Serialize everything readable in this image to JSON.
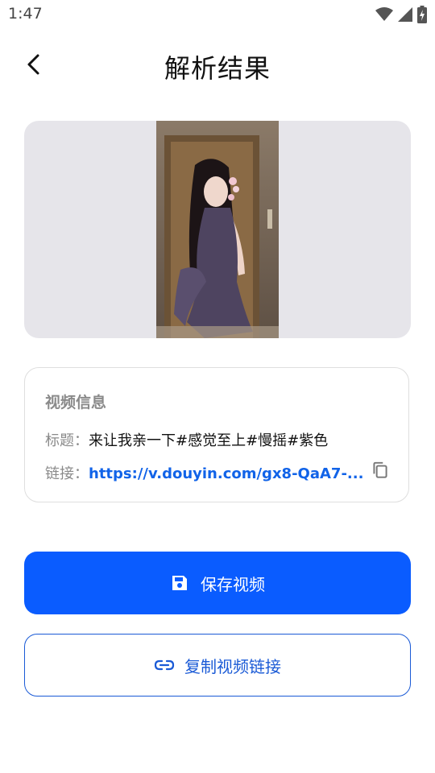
{
  "status_bar": {
    "time": "1:47",
    "icons": [
      "wifi-icon",
      "signal-icon",
      "battery-charging-icon"
    ]
  },
  "app_bar": {
    "title": "解析结果",
    "back_icon": "chevron-left-icon"
  },
  "preview": {
    "image_description": "video-thumbnail"
  },
  "info_card": {
    "heading": "视频信息",
    "title_label": "标题：",
    "title_value": "来让我亲一下#感觉至上#慢摇#紫色",
    "link_label": "链接：",
    "link_value": "https://v.douyin.com/gx8-QaA7-...",
    "copy_icon": "copy-icon"
  },
  "actions": {
    "save_label": "保存视频",
    "save_icon": "floppy-disk-icon",
    "copy_link_label": "复制视频链接",
    "copy_link_icon": "link-icon"
  },
  "colors": {
    "primary": "#0a5cff",
    "link": "#1163e8",
    "preview_bg": "#e6e5ea",
    "muted_text": "#8a8a8a"
  }
}
